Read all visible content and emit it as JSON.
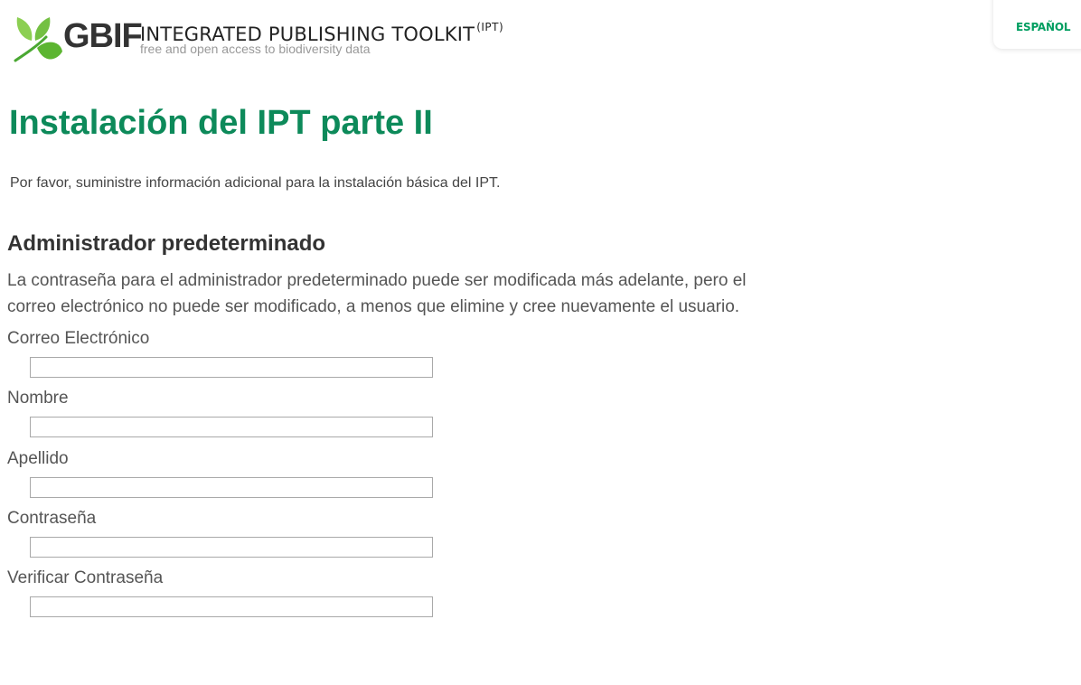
{
  "header": {
    "brand": "GBIF",
    "title": "INTEGRATED PUBLISHING TOOLKIT",
    "title_sup": "(IPT)",
    "tagline": "free and open access to biodiversity data",
    "logo_icon": "gbif-leaf-logo",
    "language_link": "ESPAÑOL"
  },
  "colors": {
    "brand_green": "#0d8a5a",
    "link_green": "#009e60",
    "text": "#333333"
  },
  "main": {
    "title": "Instalación del IPT parte II",
    "intro": "Por favor, suministre información adicional para la instalación básica del IPT.",
    "section": {
      "title": "Administrador predeterminado",
      "description": "La contraseña para el administrador predeterminado puede ser modificada más adelante, pero el correo electrónico no puede ser modificado, a menos que elimine y cree nuevamente el usuario."
    },
    "fields": [
      {
        "label": "Correo Electrónico",
        "value": ""
      },
      {
        "label": "Nombre",
        "value": ""
      },
      {
        "label": "Apellido",
        "value": ""
      },
      {
        "label": "Contraseña",
        "value": ""
      },
      {
        "label": "Verificar Contraseña",
        "value": ""
      }
    ]
  }
}
